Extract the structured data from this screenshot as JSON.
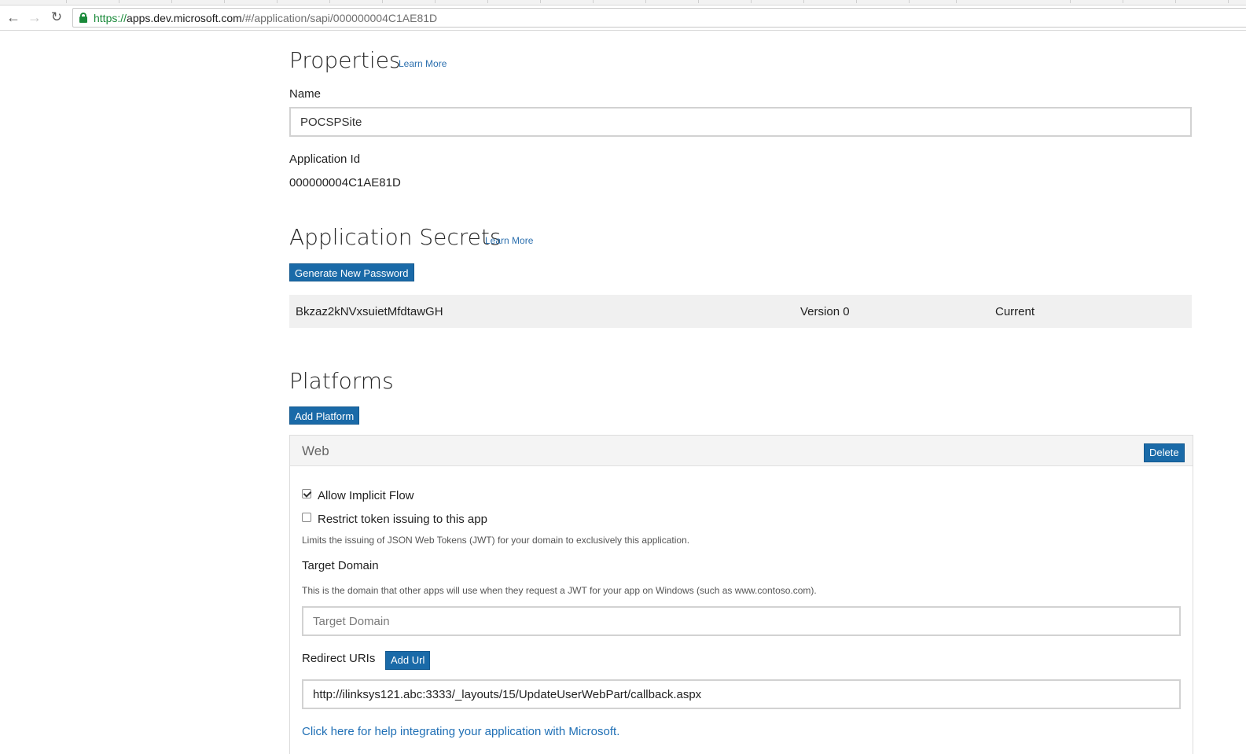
{
  "browser": {
    "url_scheme": "https://",
    "url_host": "apps.dev.microsoft.com",
    "url_path": "/#/application/sapi/000000004C1AE81D"
  },
  "properties": {
    "title": "Properties",
    "learn_more": "Learn More",
    "name_label": "Name",
    "name_value": "POCSPSite",
    "app_id_label": "Application Id",
    "app_id_value": "000000004C1AE81D"
  },
  "secrets": {
    "title": "Application Secrets",
    "learn_more": "Learn More",
    "generate_button": "Generate New Password",
    "items": [
      {
        "secret": "Bkzaz2kNVxsuietMfdtawGH",
        "version": "Version 0",
        "status": "Current"
      }
    ]
  },
  "platforms": {
    "title": "Platforms",
    "add_button": "Add Platform",
    "web": {
      "name": "Web",
      "delete_button": "Delete",
      "allow_implicit_flow": {
        "label": "Allow Implicit Flow",
        "checked": true
      },
      "restrict_token": {
        "label": "Restrict token issuing to this app",
        "checked": false
      },
      "restrict_help": "Limits the issuing of JSON Web Tokens (JWT) for your domain to exclusively this application.",
      "target_domain_label": "Target Domain",
      "target_domain_help": "This is the domain that other apps will use when they request a JWT for your app on Windows (such as www.contoso.com).",
      "target_domain_placeholder": "Target Domain",
      "redirect_label": "Redirect URIs",
      "add_url_button": "Add Url",
      "redirect_uri_value": "http://ilinksys121.abc:3333/_layouts/15/UpdateUserWebPart/callback.aspx",
      "help_link": "Click here for help integrating your application with Microsoft."
    }
  },
  "colors": {
    "primary_button": "#1a6aa8",
    "link": "#1f6fb5",
    "secure_green": "#1a8a3a"
  }
}
